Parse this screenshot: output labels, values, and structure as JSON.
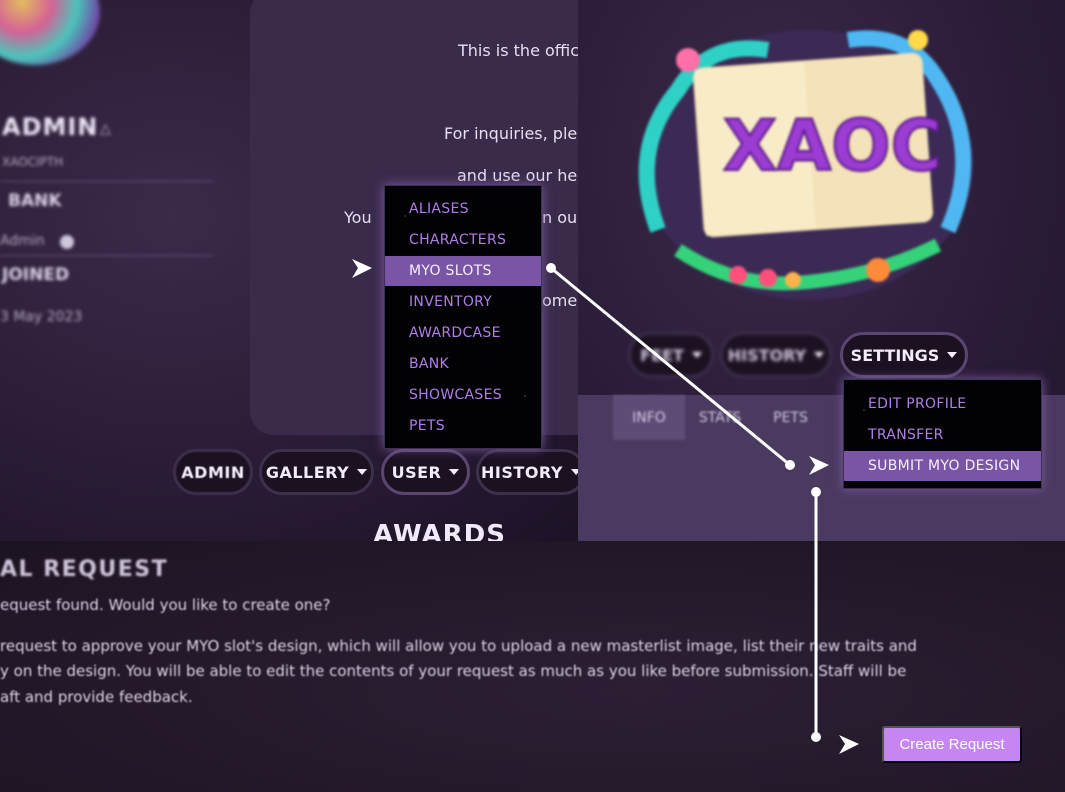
{
  "profile": {
    "username": "ADMIN",
    "sub_label": "XAOCIPTH",
    "bank_label": "BANK",
    "rank_text": "Admin",
    "joined_label": "JOINED",
    "joined_date": "3 May 2023",
    "content_lines": [
      "This is the offic",
      "For inquiries, ple",
      "and use our he",
      "You",
      "n our",
      "ome"
    ],
    "nav": {
      "admin": "ADMIN",
      "gallery": "GALLERY",
      "user": "USER",
      "history": "HISTORY"
    },
    "awards_heading": "AWARDS",
    "user_menu": [
      "ALIASES",
      "CHARACTERS",
      "MYO SLOTS",
      "INVENTORY",
      "AWARDCASE",
      "BANK",
      "SHOWCASES",
      "PETS"
    ],
    "user_menu_selected": "MYO SLOTS"
  },
  "character": {
    "logo_text": "XAOC",
    "nav": {
      "left1": "FEET",
      "left2": "HISTORY",
      "settings": "SETTINGS"
    },
    "tabs": [
      "INFO",
      "STATS",
      "PETS"
    ],
    "settings_menu": [
      "EDIT PROFILE",
      "TRANSFER",
      "SUBMIT MYO DESIGN"
    ],
    "settings_menu_selected": "SUBMIT MYO DESIGN"
  },
  "request": {
    "title": "AL REQUEST",
    "line1": "equest found. Would you like to create one?",
    "line2": "request to approve your MYO slot's design, which will allow you to upload a new masterlist image, list their new traits and",
    "line3": "y on the design. You will be able to edit the contents of your request as much as you like before submission. Staff will be",
    "line4": "aft and provide feedback.",
    "create_button": "Create Request"
  },
  "colors": {
    "accent": "#c586f2",
    "menu_text": "#b07ee8",
    "menu_selected_bg": "#7a55a6",
    "pill_bg": "#1b1121"
  },
  "icons": [
    "triangle-icon",
    "info-circle-icon",
    "caret-down-icon",
    "pointer-arrow-icon"
  ]
}
